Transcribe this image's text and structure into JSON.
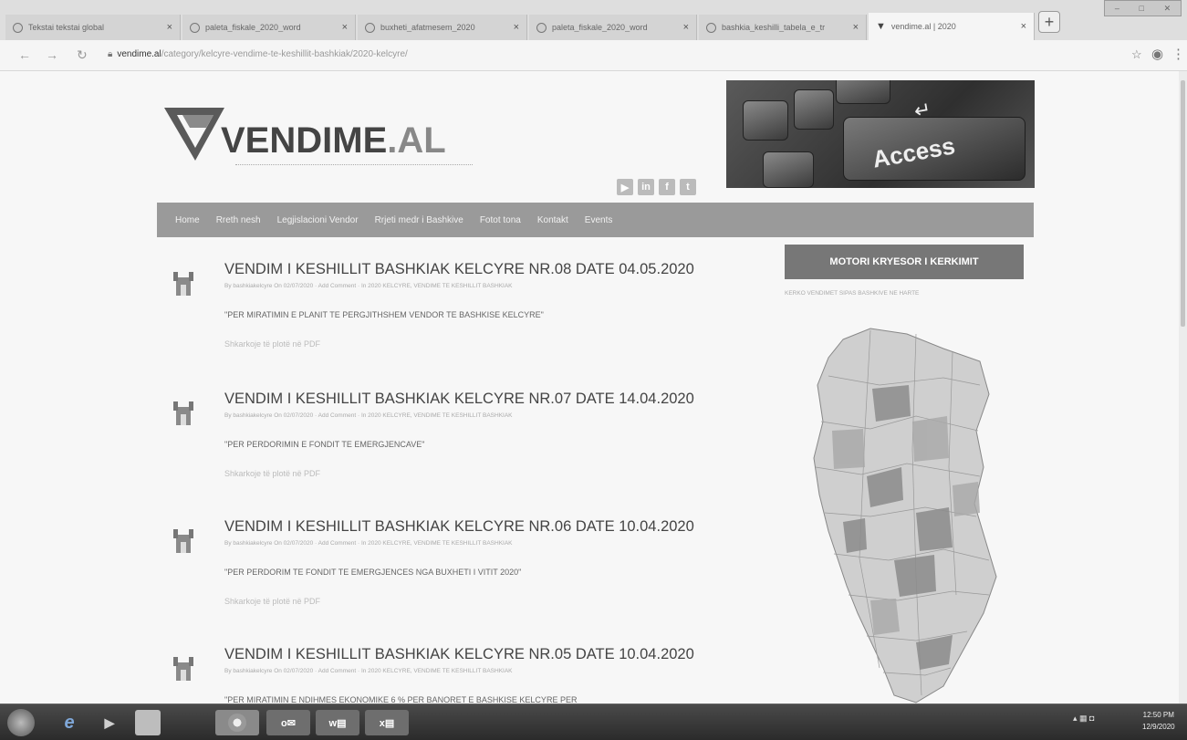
{
  "tabs": [
    {
      "label": "Tekstai tekstai global",
      "active": false
    },
    {
      "label": "paleta_fiskale_2020_word",
      "active": false
    },
    {
      "label": "buxheti_afatmesem_2020",
      "active": false
    },
    {
      "label": "paleta_fiskale_2020_word",
      "active": false
    },
    {
      "label": "bashkia_keshilli_tabela_e_tr",
      "active": false
    },
    {
      "label": "vendime.al | 2020",
      "active": true
    }
  ],
  "address_bar": {
    "domain": "vendime.al",
    "path": "/category/kelcyre-vendime-te-keshillit-bashkiak/2020-kelcyre/"
  },
  "site": {
    "logo_main": "VENDIME",
    "logo_suffix": ".AL",
    "banner_key": "Access"
  },
  "nav": {
    "items": [
      "Home",
      "Rreth nesh",
      "Legjislacioni Vendor",
      "Rrjeti medr i Bashkive",
      "Fotot tona",
      "Kontakt",
      "Events"
    ]
  },
  "posts": [
    {
      "title": "VENDIM I KESHILLIT BASHKIAK KELCYRE NR.08 DATE 04.05.2020",
      "meta": "By bashkiakelcyre On 02/07/2020 · Add Comment · In 2020 KELCYRE, VENDIME TE KESHILLIT BASHKIAK",
      "description": "\"PER MIRATIMIN E PLANIT TE PERGJITHSHEM VENDOR TE BASHKISE KELCYRE\"",
      "link": "Shkarkoje të plotë në PDF"
    },
    {
      "title": "VENDIM I KESHILLIT BASHKIAK KELCYRE NR.07 DATE 14.04.2020",
      "meta": "By bashkiakelcyre On 02/07/2020 · Add Comment · In 2020 KELCYRE, VENDIME TE KESHILLIT BASHKIAK",
      "description": "\"PER PERDORIMIN E FONDIT TE EMERGJENCAVE\"",
      "link": "Shkarkoje të plotë në PDF"
    },
    {
      "title": "VENDIM I KESHILLIT BASHKIAK KELCYRE NR.06 DATE 10.04.2020",
      "meta": "By bashkiakelcyre On 02/07/2020 · Add Comment · In 2020 KELCYRE, VENDIME TE KESHILLIT BASHKIAK",
      "description": "\"PER PERDORIM TE FONDIT TE EMERGJENCES NGA BUXHETI I VITIT 2020\"",
      "link": "Shkarkoje të plotë në PDF"
    },
    {
      "title": "VENDIM I KESHILLIT BASHKIAK KELCYRE NR.05 DATE 10.04.2020",
      "meta": "By bashkiakelcyre On 02/07/2020 · Add Comment · In 2020 KELCYRE, VENDIME TE KESHILLIT BASHKIAK",
      "description": "\"PER MIRATIMIN E NDIHMES EKONOMIKE 6 % PER BANORET E BASHKISE KELCYRE PER",
      "link": ""
    }
  ],
  "sidebar": {
    "search_title": "MOTORI KRYESOR I KERKIMIT",
    "subtitle": "KERKO VENDIMET SIPAS BASHKIVE NE HARTE"
  },
  "taskbar": {
    "time": "12:50 PM",
    "date": "12/9/2020"
  },
  "colors": {
    "nav_bg": "#9a9a9a",
    "sidebar_button": "#777777",
    "logo_mark": "#5a5a5a"
  }
}
